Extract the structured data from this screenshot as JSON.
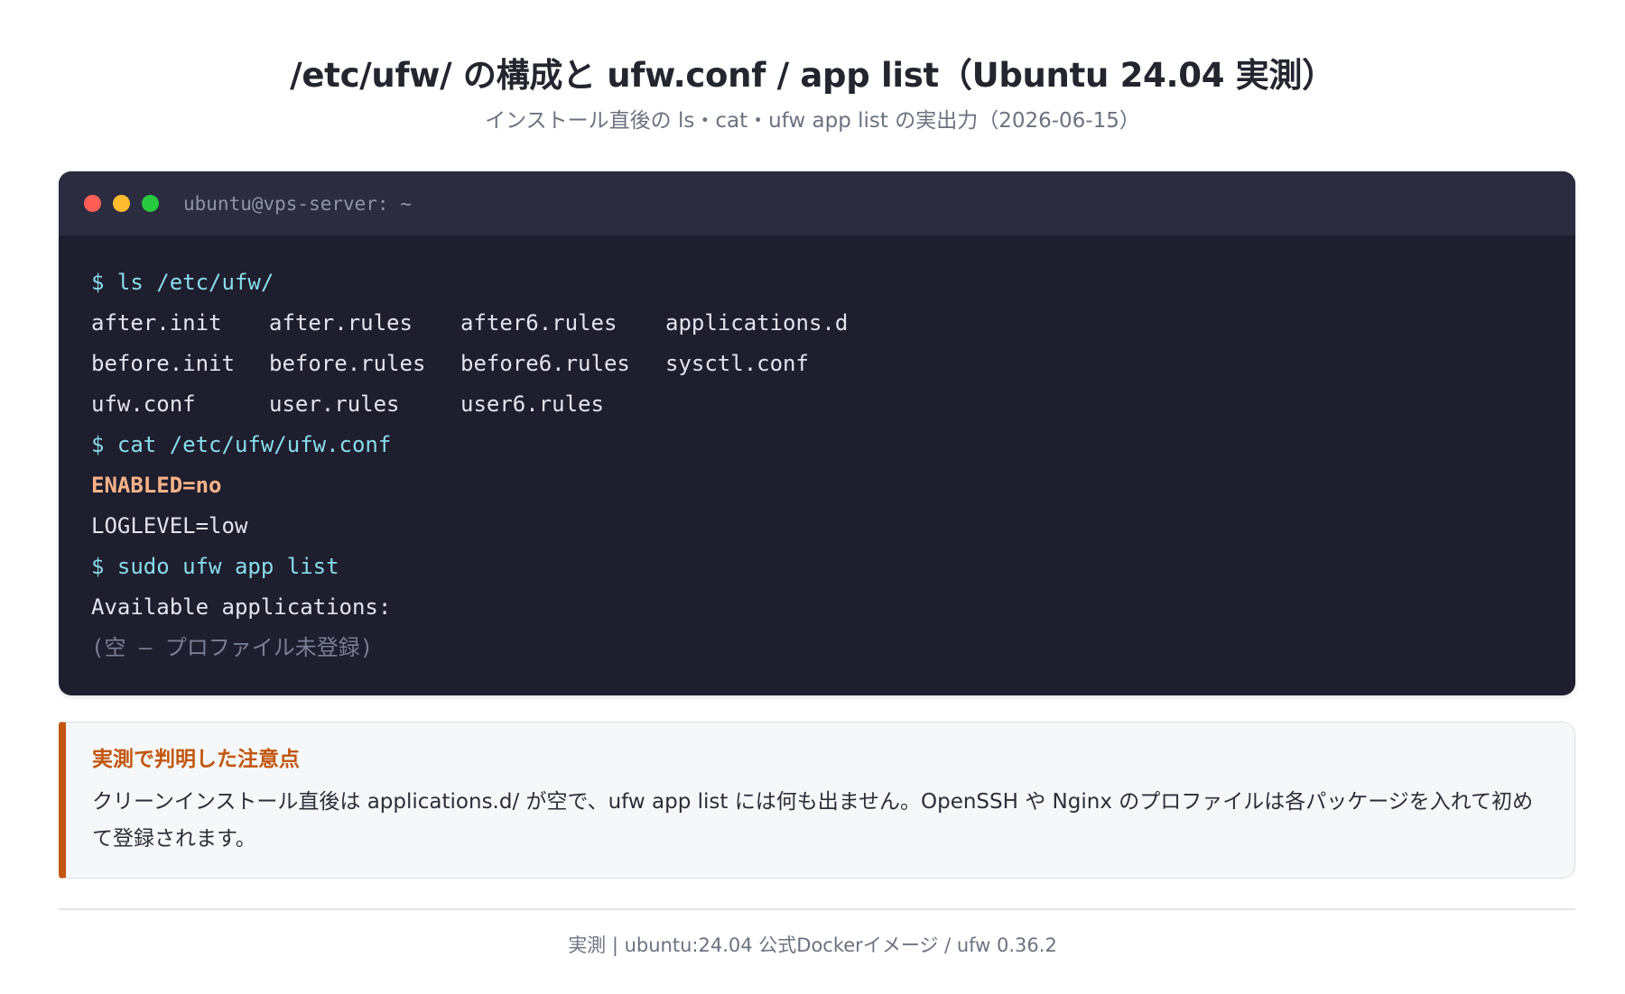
{
  "header": {
    "title": "/etc/ufw/ の構成と ufw.conf / app list（Ubuntu 24.04 実測）",
    "subtitle": "インストール直後の ls・cat・ufw app list の実出力（2026-06-15）"
  },
  "terminal": {
    "title": "ubuntu@vps-server: ~",
    "colors": {
      "background": "#1e1e2e",
      "titlebar": "#2b2c40",
      "command": "#89dceb",
      "highlight": "#fab387",
      "muted": "#7b7f94",
      "dot_red": "#ff5f57",
      "dot_yellow": "#febc2e",
      "dot_green": "#28c840"
    },
    "cmd_ls": "$ ls /etc/ufw/",
    "ls_rows": [
      [
        "after.init",
        "after.rules",
        "after6.rules",
        "applications.d"
      ],
      [
        "before.init",
        "before.rules",
        "before6.rules",
        "sysctl.conf"
      ],
      [
        "ufw.conf",
        "user.rules",
        "user6.rules",
        ""
      ]
    ],
    "cmd_cat": "$ cat /etc/ufw/ufw.conf",
    "conf_enabled": "ENABLED=no",
    "conf_loglevel": "LOGLEVEL=low",
    "cmd_app": "$ sudo ufw app list",
    "app_header": "Available applications:",
    "app_empty": "(空 — プロファイル未登録)"
  },
  "note": {
    "title": "実測で判明した注意点",
    "body": "クリーンインストール直後は applications.d/ が空で、ufw app list には何も出ません。OpenSSH や Nginx のプロファイルは各パッケージを入れて初めて登録されます。",
    "accent_color": "#c2560f"
  },
  "footer": {
    "text": "実測 | ubuntu:24.04 公式Dockerイメージ / ufw 0.36.2"
  }
}
